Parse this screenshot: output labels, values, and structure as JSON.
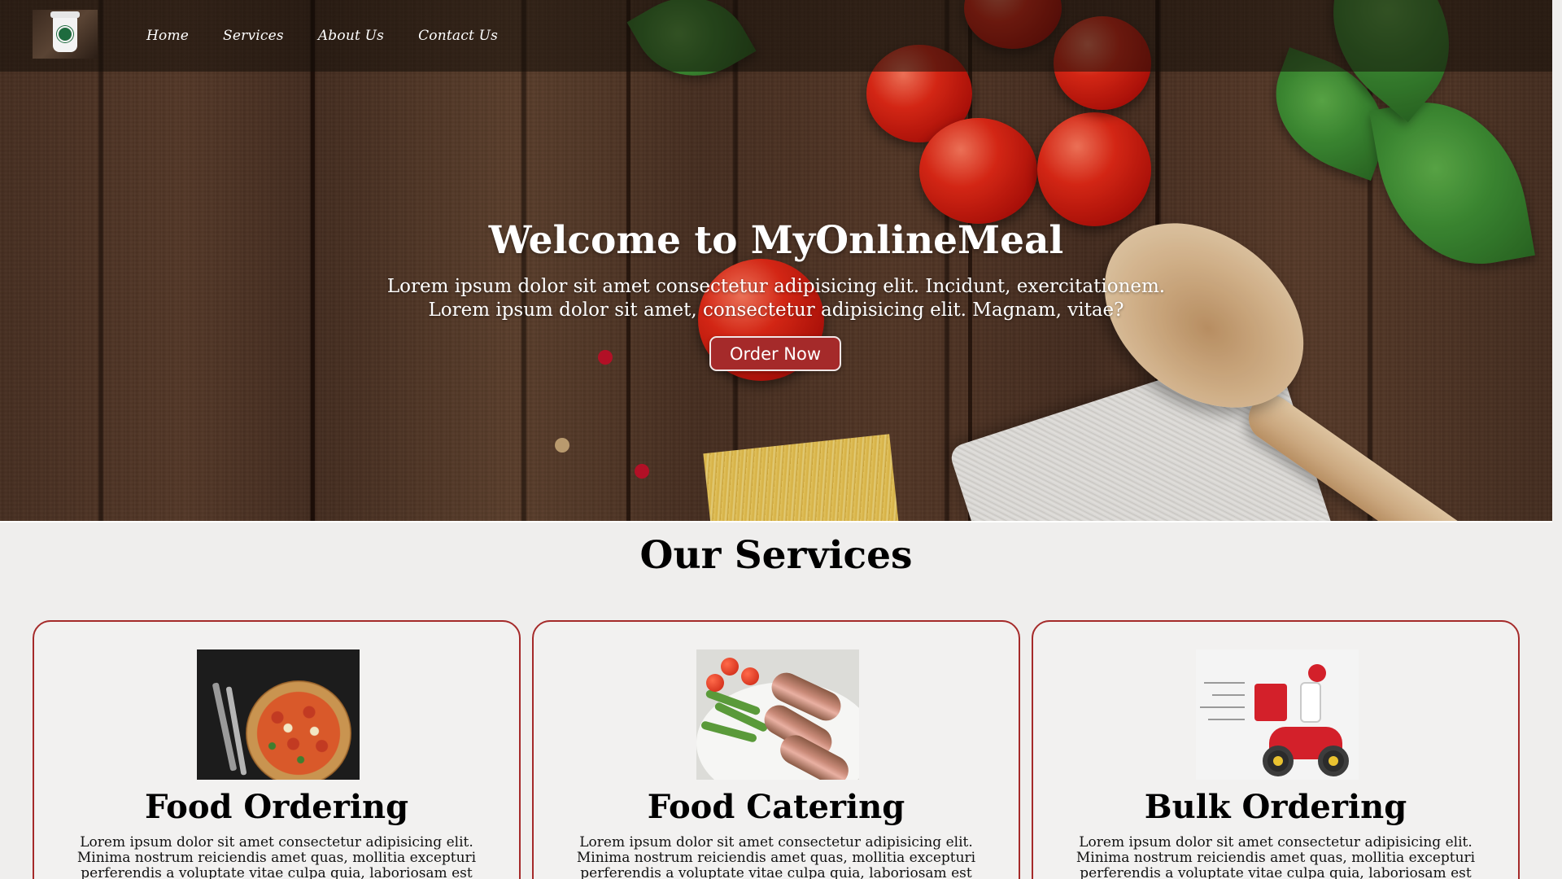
{
  "nav": {
    "logo_icon": "coffee-cup-icon",
    "links": [
      "Home",
      "Services",
      "About Us",
      "Contact Us"
    ]
  },
  "hero": {
    "title": "Welcome to MyOnlineMeal",
    "subtitle_line1": "Lorem ipsum dolor sit amet consectetur adipisicing elit. Incidunt, exercitationem.",
    "subtitle_line2": "Lorem ipsum dolor sit amet, consectetur adipisicing elit. Magnam, vitae?",
    "cta_label": "Order Now"
  },
  "services": {
    "title": "Our Services",
    "cards": [
      {
        "title": "Food Ordering",
        "image": "pizza-image",
        "text": "Lorem ipsum dolor sit amet consectetur adipisicing elit. Minima nostrum reiciendis amet quas, mollitia excepturi perferendis a voluptate vitae culpa quia, laboriosam est ratione placeat ipsum"
      },
      {
        "title": "Food Catering",
        "image": "steak-plate-image",
        "text": "Lorem ipsum dolor sit amet consectetur adipisicing elit. Minima nostrum reiciendis amet quas, mollitia excepturi perferendis a voluptate vitae culpa quia, laboriosam est ratione placeat ipsum"
      },
      {
        "title": "Bulk Ordering",
        "image": "delivery-scooter-image",
        "text": "Lorem ipsum dolor sit amet consectetur adipisicing elit. Minima nostrum reiciendis amet quas, mollitia excepturi perferendis a voluptate vitae culpa quia, laboriosam est ratione placeat ipsum"
      }
    ]
  },
  "colors": {
    "accent": "#a52a2a",
    "page_background": "#efeeed",
    "nav_overlay": "#1a120c"
  }
}
